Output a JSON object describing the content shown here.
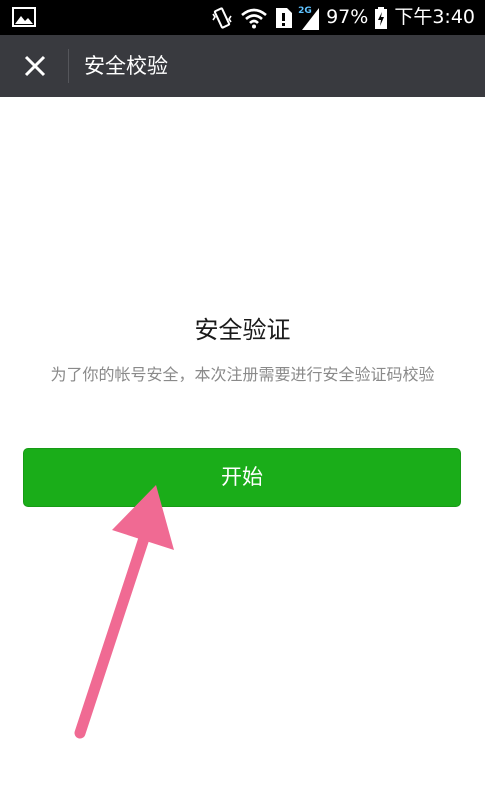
{
  "status_bar": {
    "battery": "97%",
    "time": "下午3:40",
    "network_label": "2G",
    "icons": [
      "gallery-icon",
      "vibrate-icon",
      "wifi-icon",
      "sim-icon",
      "signal-icon",
      "battery-charging-icon"
    ]
  },
  "title_bar": {
    "title": "安全校验",
    "close_icon": "close-icon"
  },
  "main": {
    "heading": "安全验证",
    "description": "为了你的帐号安全，本次注册需要进行安全验证码校验",
    "start_button_label": "开始"
  },
  "annotation": {
    "arrow_color": "#f06a93"
  },
  "colors": {
    "title_bar_bg": "#393a3f",
    "button_green": "#1aad19",
    "status_bar_bg": "#000000"
  }
}
